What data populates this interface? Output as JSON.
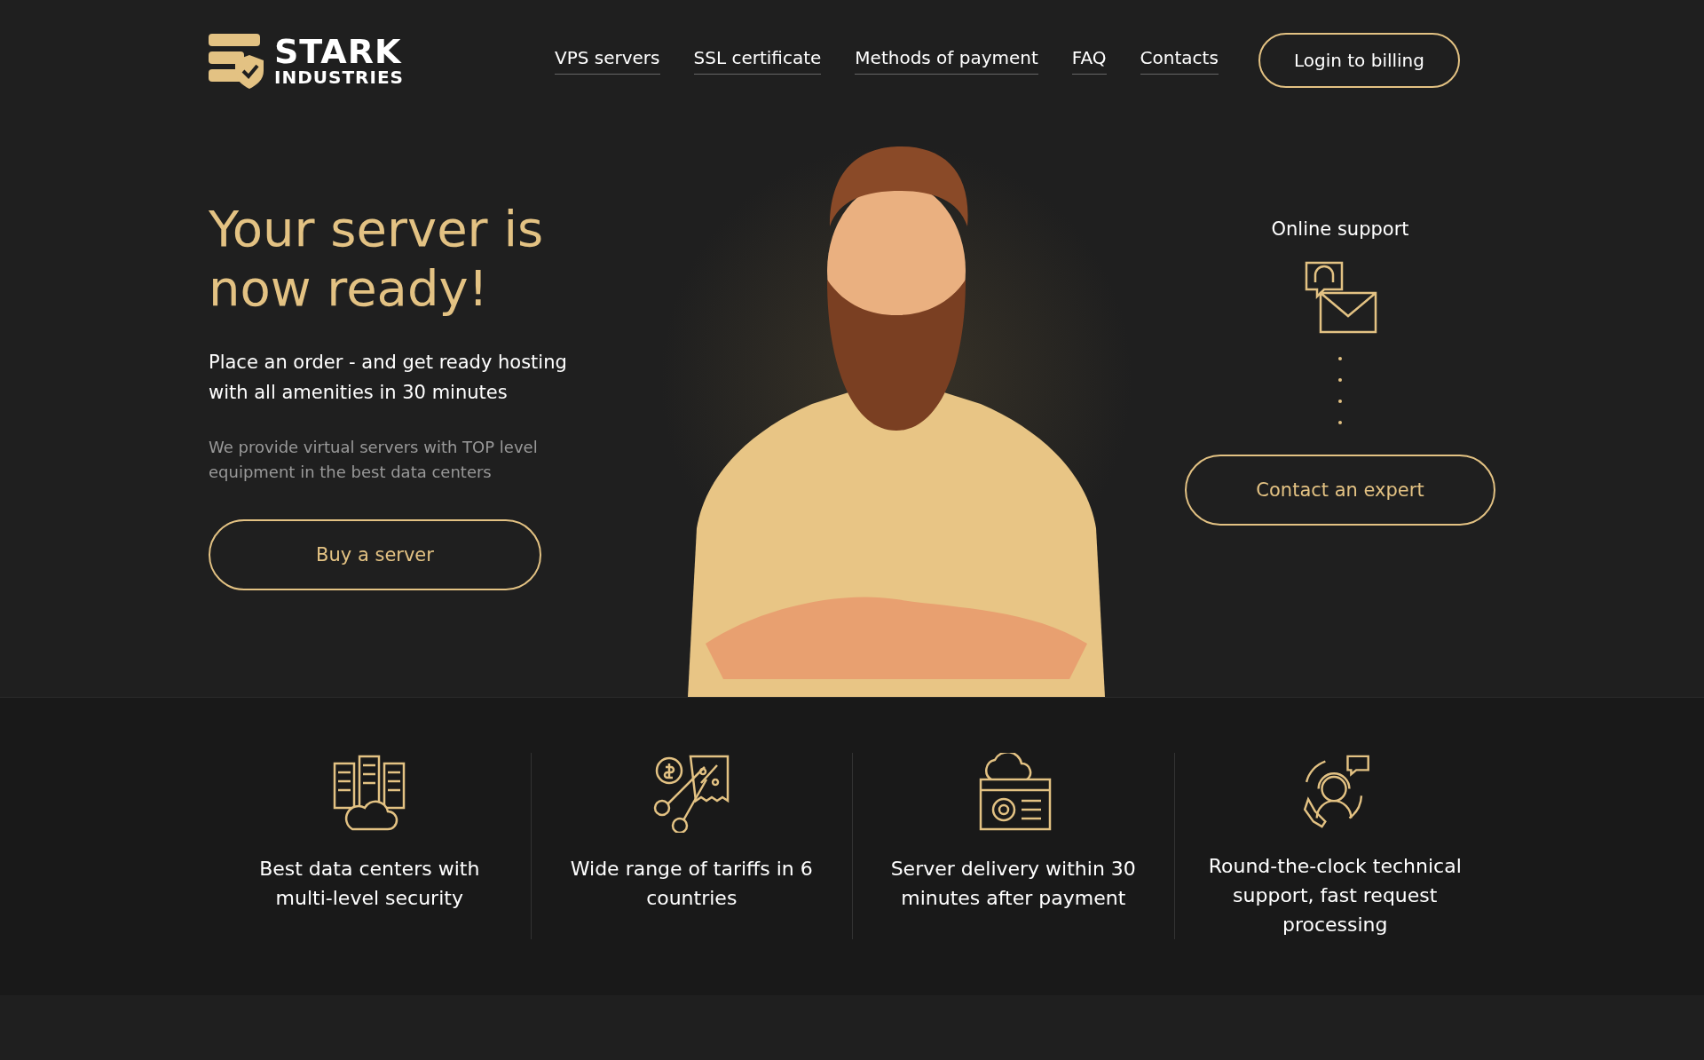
{
  "logo": {
    "line1": "STARK",
    "line2": "INDUSTRIES"
  },
  "nav": [
    {
      "label": "VPS servers"
    },
    {
      "label": "SSL certificate"
    },
    {
      "label": "Methods of payment"
    },
    {
      "label": "FAQ"
    },
    {
      "label": "Contacts"
    }
  ],
  "login_button": "Login to billing",
  "hero": {
    "title_line1": "Your server is",
    "title_line2": "now ready!",
    "subtitle": "Place an order - and get ready hosting with all amenities in 30 minutes",
    "description": "We provide virtual servers with TOP level equipment in the best data centers",
    "button": "Buy a server"
  },
  "support": {
    "title": "Online support",
    "button": "Contact an expert"
  },
  "features": [
    {
      "kind": "datacenter",
      "text": "Best data centers with multi-level security"
    },
    {
      "kind": "tariffs",
      "text": "Wide range of tariffs in 6 countries"
    },
    {
      "kind": "delivery",
      "text": "Server delivery within 30 minutes after payment"
    },
    {
      "kind": "support",
      "text": "Round-the-clock technical support, fast request processing"
    }
  ]
}
